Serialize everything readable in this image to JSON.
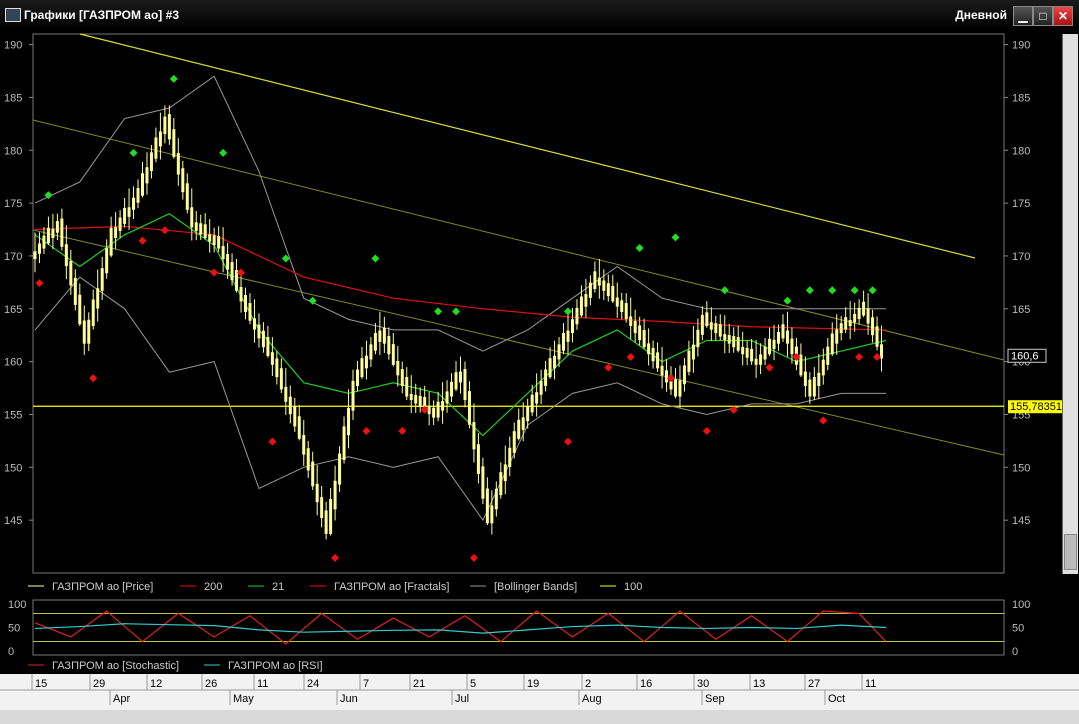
{
  "window": {
    "title": "Графики [ГАЗПРОМ ао] #3",
    "period": "Дневной",
    "minimize": "▁",
    "maximize": "□",
    "close": "✕"
  },
  "chart_data": [
    {
      "type": "line",
      "title": "",
      "ylim": [
        140,
        191
      ],
      "yticks": [
        145,
        150,
        155,
        160,
        165,
        170,
        175,
        180,
        185,
        190
      ],
      "price_label": "160,6",
      "hline_label": "155,78351",
      "hline_value": 155.78,
      "price_last": 160.6,
      "x_days": 190,
      "legend": [
        "ГАЗПРОМ ао [Price]",
        "200",
        "21",
        "ГАЗПРОМ ао [Fractals]",
        "[Bollinger Bands]",
        "100"
      ],
      "colors": {
        "price": "#ffff99",
        "ma200": "#dd1111",
        "ma21": "#22cc22",
        "fractal_up": "#22dd22",
        "fractal_down": "#ee1111",
        "bollinger": "#999999",
        "hline": "#ffff00",
        "trend": "#cccc33"
      },
      "series": [
        {
          "name": "ГАЗПРОМ ао [Price]",
          "x": [
            0,
            6,
            12,
            18,
            24,
            30,
            36,
            42,
            48,
            54,
            60,
            66,
            72,
            78,
            84,
            90,
            96,
            102,
            108,
            114,
            120,
            126,
            132,
            138,
            144,
            150,
            156,
            162,
            168,
            174,
            180,
            186,
            190
          ],
          "values": [
            170,
            173,
            162,
            172,
            176,
            183,
            173,
            171,
            165,
            160,
            153,
            144,
            158,
            163,
            157,
            155,
            159,
            145,
            153,
            158,
            163,
            168,
            165,
            161,
            157,
            164,
            162,
            160,
            163,
            157,
            163,
            165,
            160.6
          ]
        },
        {
          "name": "200",
          "x": [
            0,
            20,
            40,
            60,
            80,
            100,
            120,
            140,
            160,
            190
          ],
          "values": [
            172.5,
            172.8,
            172,
            168,
            166,
            165,
            164.2,
            163.8,
            163.3,
            163
          ]
        },
        {
          "name": "21",
          "x": [
            0,
            10,
            20,
            30,
            40,
            50,
            60,
            70,
            80,
            90,
            100,
            110,
            120,
            130,
            140,
            150,
            160,
            170,
            180,
            190
          ],
          "values": [
            172,
            169,
            172,
            174,
            171,
            163,
            158,
            157,
            158,
            157,
            153,
            157,
            161,
            163,
            160,
            162,
            162,
            160,
            161,
            162
          ]
        },
        {
          "name": "[Bollinger Bands]",
          "x": [
            0,
            10,
            20,
            30,
            40,
            50,
            60,
            70,
            80,
            90,
            100,
            110,
            120,
            130,
            140,
            150,
            160,
            170,
            180,
            190
          ],
          "values": [
            175,
            177,
            183,
            184,
            187,
            178,
            166,
            164,
            163,
            163,
            161,
            163,
            166,
            169,
            166,
            165,
            165,
            165,
            165,
            165
          ]
        },
        {
          "name": "[Bollinger Bands]",
          "x": [
            0,
            10,
            20,
            30,
            40,
            50,
            60,
            70,
            80,
            90,
            100,
            110,
            120,
            130,
            140,
            150,
            160,
            170,
            180,
            190
          ],
          "values": [
            163,
            168,
            165,
            159,
            160,
            148,
            150,
            151,
            150,
            151,
            145,
            154,
            157,
            158,
            156,
            155,
            156,
            156,
            157,
            157
          ]
        }
      ],
      "fractals_up": [
        [
          3,
          175
        ],
        [
          22,
          179
        ],
        [
          31,
          186
        ],
        [
          42,
          179
        ],
        [
          56,
          169
        ],
        [
          62,
          165
        ],
        [
          76,
          169
        ],
        [
          90,
          164
        ],
        [
          94,
          164
        ],
        [
          119,
          164
        ],
        [
          135,
          170
        ],
        [
          143,
          171
        ],
        [
          154,
          166
        ],
        [
          168,
          165
        ],
        [
          173,
          166
        ],
        [
          178,
          166
        ],
        [
          183,
          166
        ],
        [
          187,
          166
        ]
      ],
      "fractals_down": [
        [
          1,
          168
        ],
        [
          13,
          159
        ],
        [
          24,
          172
        ],
        [
          29,
          173
        ],
        [
          40,
          169
        ],
        [
          46,
          169
        ],
        [
          53,
          153
        ],
        [
          67,
          142
        ],
        [
          74,
          154
        ],
        [
          82,
          154
        ],
        [
          87,
          156
        ],
        [
          98,
          142
        ],
        [
          119,
          153
        ],
        [
          128,
          160
        ],
        [
          133,
          161
        ],
        [
          142,
          159
        ],
        [
          150,
          154
        ],
        [
          156,
          156
        ],
        [
          164,
          160
        ],
        [
          170,
          161
        ],
        [
          176,
          155
        ],
        [
          184,
          161
        ],
        [
          188,
          161
        ]
      ]
    },
    {
      "type": "line",
      "title": "",
      "ylim": [
        0,
        100
      ],
      "yticks": [
        0,
        50,
        100
      ],
      "legend": [
        "ГАЗПРОМ ао [Stochastic]",
        "ГАЗПРОМ ао [RSI]"
      ],
      "colors": {
        "stochastic": "#dd2222",
        "rsi": "#33cccc",
        "levels": "#ffff66"
      },
      "levels": [
        20,
        80
      ],
      "series": [
        {
          "name": "ГАЗПРОМ ао [Stochastic]",
          "x": [
            0,
            8,
            16,
            24,
            32,
            40,
            48,
            56,
            64,
            72,
            80,
            88,
            96,
            104,
            112,
            120,
            128,
            136,
            144,
            152,
            160,
            168,
            176,
            184,
            190
          ],
          "values": [
            60,
            30,
            85,
            20,
            80,
            30,
            75,
            15,
            80,
            25,
            70,
            30,
            75,
            20,
            85,
            30,
            80,
            20,
            85,
            25,
            75,
            20,
            85,
            80,
            20
          ]
        },
        {
          "name": "ГАЗПРОМ ао [RSI]",
          "x": [
            0,
            10,
            20,
            30,
            40,
            50,
            60,
            70,
            80,
            90,
            100,
            110,
            120,
            130,
            140,
            150,
            160,
            170,
            180,
            190
          ],
          "values": [
            48,
            52,
            58,
            56,
            54,
            45,
            40,
            42,
            44,
            45,
            38,
            45,
            52,
            55,
            50,
            48,
            50,
            48,
            55,
            50
          ]
        }
      ]
    }
  ],
  "date_axis": {
    "day_labels": [
      "15",
      "29",
      "12",
      "26",
      "11",
      "24",
      "7",
      "21",
      "5",
      "19",
      "2",
      "16",
      "30",
      "13",
      "27",
      "11"
    ],
    "month_labels": [
      "Apr",
      "May",
      "Jun",
      "Jul",
      "Aug",
      "Sep",
      "Oct"
    ]
  }
}
